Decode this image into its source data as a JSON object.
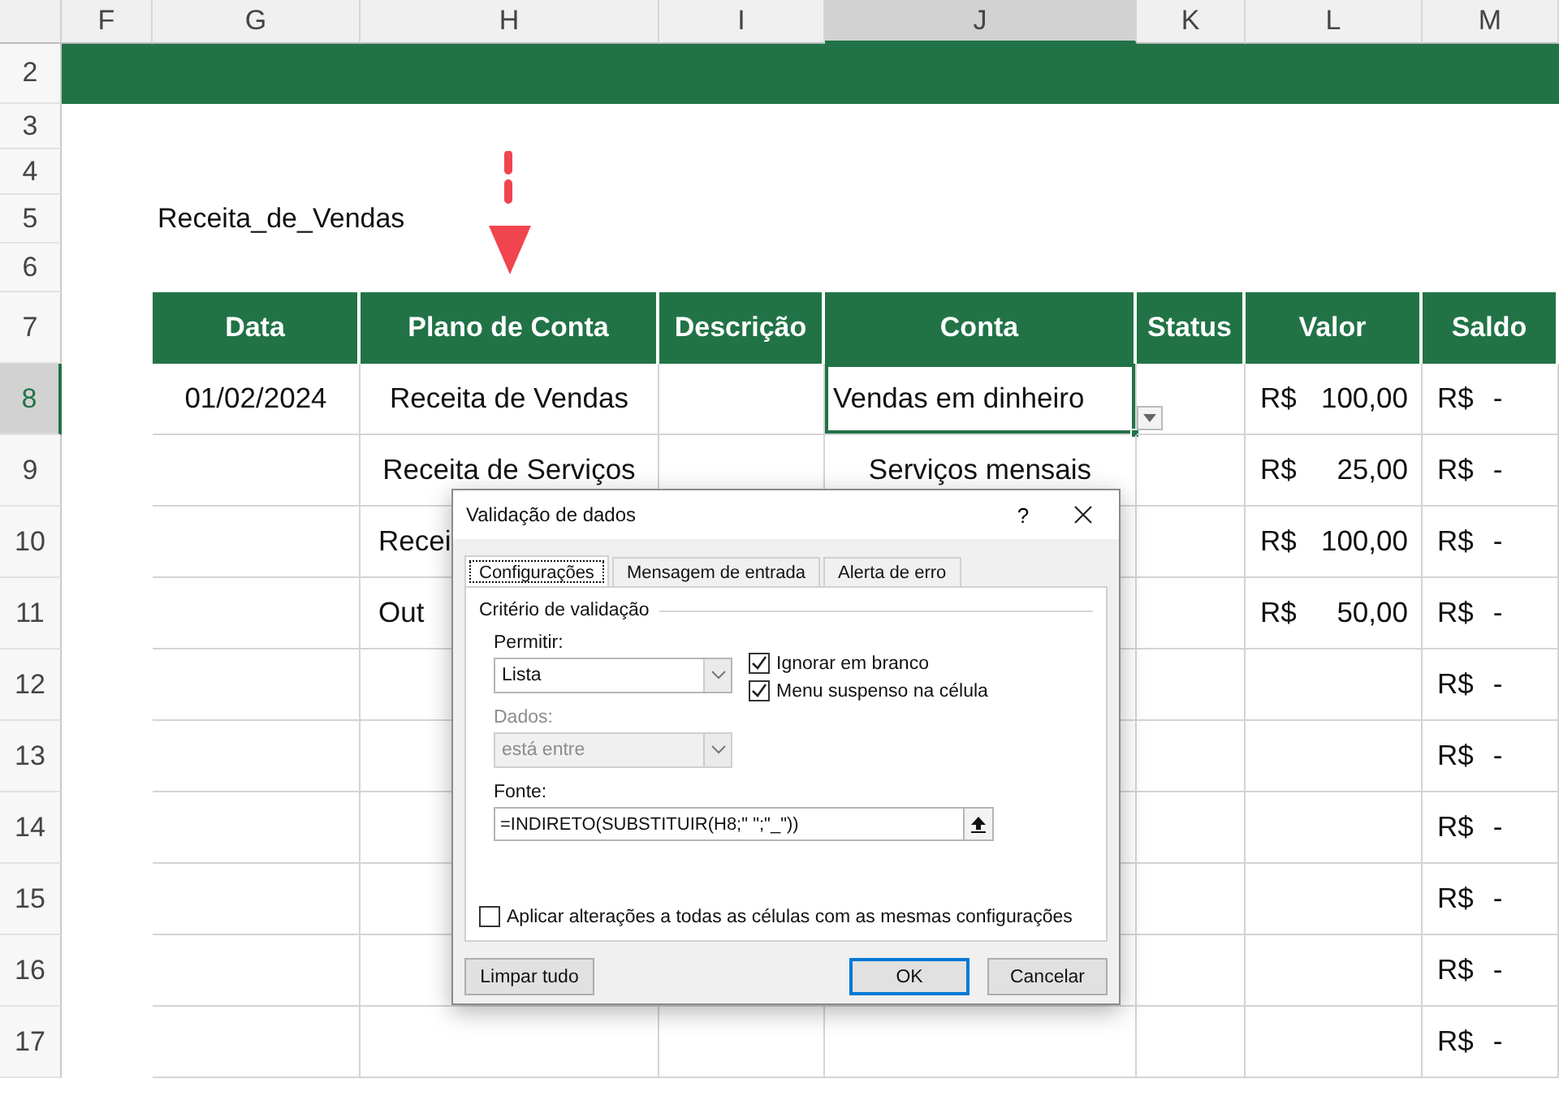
{
  "column_headers": [
    {
      "label": "F",
      "selected": false
    },
    {
      "label": "G",
      "selected": false
    },
    {
      "label": "H",
      "selected": false
    },
    {
      "label": "I",
      "selected": false
    },
    {
      "label": "J",
      "selected": true
    },
    {
      "label": "K",
      "selected": false
    },
    {
      "label": "L",
      "selected": false
    },
    {
      "label": "M",
      "selected": false
    }
  ],
  "row_numbers": [
    {
      "label": "2",
      "selected": false
    },
    {
      "label": "3",
      "selected": false
    },
    {
      "label": "4",
      "selected": false
    },
    {
      "label": "5",
      "selected": false
    },
    {
      "label": "6",
      "selected": false
    },
    {
      "label": "7",
      "selected": false
    },
    {
      "label": "8",
      "selected": true
    },
    {
      "label": "9",
      "selected": false
    },
    {
      "label": "10",
      "selected": false
    },
    {
      "label": "11",
      "selected": false
    },
    {
      "label": "12",
      "selected": false
    },
    {
      "label": "13",
      "selected": false
    },
    {
      "label": "14",
      "selected": false
    },
    {
      "label": "15",
      "selected": false
    },
    {
      "label": "16",
      "selected": false
    },
    {
      "label": "17",
      "selected": false
    }
  ],
  "range_name": "Receita_de_Vendas",
  "table": {
    "columns": [
      "Data",
      "Plano de Conta",
      "Descrição",
      "Conta",
      "Status",
      "Valor",
      "Saldo"
    ],
    "rows": [
      {
        "data": "01/02/2024",
        "plano": "Receita de Vendas",
        "conta": "Vendas em dinheiro",
        "valor": {
          "symbol": "R$",
          "amount": "100,00"
        },
        "saldo": {
          "symbol": "R$",
          "amount": "-"
        },
        "selected": true
      },
      {
        "plano": "Receita de Serviços",
        "conta": "Serviços mensais",
        "valor": {
          "symbol": "R$",
          "amount": "25,00"
        },
        "saldo": {
          "symbol": "R$",
          "amount": "-"
        },
        "selected": false
      },
      {
        "plano": "Recei",
        "plano_clipped": true,
        "valor": {
          "symbol": "R$",
          "amount": "100,00"
        },
        "saldo": {
          "symbol": "R$",
          "amount": "-"
        },
        "selected": false
      },
      {
        "plano": "Out",
        "plano_clipped": true,
        "valor": {
          "symbol": "R$",
          "amount": "50,00"
        },
        "saldo": {
          "symbol": "R$",
          "amount": "-"
        },
        "selected": false
      },
      {
        "saldo": {
          "symbol": "R$",
          "amount": "-"
        },
        "selected": false
      },
      {
        "saldo": {
          "symbol": "R$",
          "amount": "-"
        },
        "selected": false
      },
      {
        "saldo": {
          "symbol": "R$",
          "amount": "-"
        },
        "selected": false
      },
      {
        "saldo": {
          "symbol": "R$",
          "amount": "-"
        },
        "selected": false
      },
      {
        "saldo": {
          "symbol": "R$",
          "amount": "-"
        },
        "selected": false
      },
      {
        "saldo": {
          "symbol": "R$",
          "amount": "-"
        },
        "selected": false
      }
    ]
  },
  "dialog": {
    "title": "Validação de dados",
    "help": "?",
    "tabs": [
      {
        "label": "Configurações",
        "selected": true
      },
      {
        "label": "Mensagem de entrada",
        "selected": false
      },
      {
        "label": "Alerta de erro",
        "selected": false
      }
    ],
    "group_label": "Critério de validação",
    "allow": {
      "label": "Permitir:",
      "value": "Lista",
      "disabled": false
    },
    "data": {
      "label": "Dados:",
      "value": "está entre",
      "disabled": true
    },
    "options": [
      {
        "label": "Ignorar em branco",
        "checked": true
      },
      {
        "label": "Menu suspenso na célula",
        "checked": true
      }
    ],
    "source": {
      "label": "Fonte:",
      "value": "=INDIRETO(SUBSTITUIR(H8;\" \";\"_\"))"
    },
    "apply_all": {
      "label": "Aplicar alterações a todas as células com as mesmas configurações",
      "checked": false
    },
    "buttons": [
      {
        "label": "Limpar tudo",
        "default": false
      },
      {
        "label": "OK",
        "default": true
      },
      {
        "label": "Cancelar",
        "default": false
      }
    ]
  }
}
